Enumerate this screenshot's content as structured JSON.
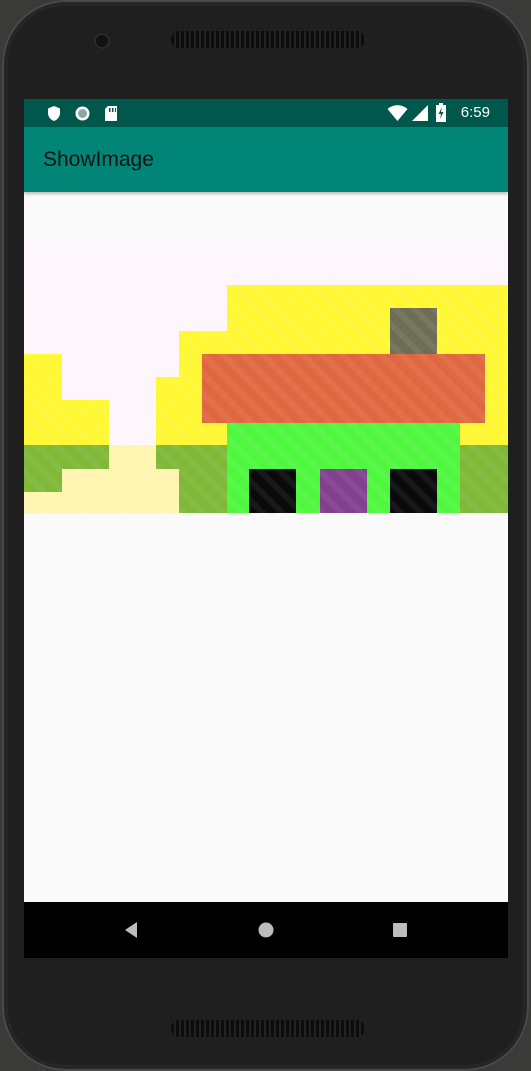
{
  "status_bar": {
    "time": "6:59",
    "left_icons": [
      "shield-icon",
      "circle-sync-icon",
      "sd-card-icon"
    ],
    "right_icons": [
      "wifi-icon",
      "signal-icon",
      "battery-charging-icon"
    ],
    "background": "#00574b"
  },
  "app_bar": {
    "title": "ShowImage",
    "background": "#008577"
  },
  "image": {
    "description_icon": "pixel-art-house-landscape",
    "colors": {
      "sky": "#fdf6fc",
      "sun_yellow": "#fff833",
      "grass": "#80b838",
      "path": "#fff5b0",
      "roof": "#e06840",
      "chimney": "#6e6e58",
      "house": "#4ff73e",
      "window": "#0a0a0a",
      "door": "#82408e"
    }
  },
  "nav_bar": {
    "buttons": [
      "back-icon",
      "home-icon",
      "recents-icon"
    ]
  }
}
